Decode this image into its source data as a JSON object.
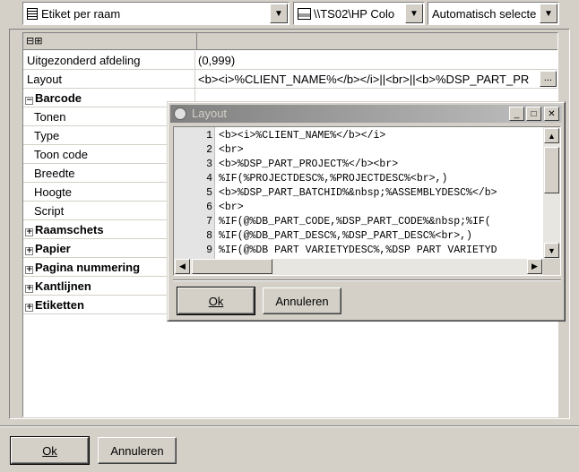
{
  "toolbar": {
    "template_value": "Etiket per raam",
    "template_icon": "grid-list-icon",
    "printer_value": "\\\\TS02\\HP Colo",
    "printer_icon": "printer-icon",
    "mode_value": "Automatisch selecte"
  },
  "grid": {
    "header_expand_glyphs": "⊟⊞",
    "rows": [
      {
        "label": "Uitgezonderd afdeling",
        "value": "(0,999)"
      },
      {
        "label": "Layout",
        "value": "<b><i>%CLIENT_NAME%</b></i>||<br>||<b>%DSP_PART_PR",
        "button": "..."
      },
      {
        "label": "Barcode",
        "expander": "−"
      },
      {
        "label": "Tonen"
      },
      {
        "label": "Type"
      },
      {
        "label": "Toon code"
      },
      {
        "label": "Breedte"
      },
      {
        "label": "Hoogte"
      },
      {
        "label": "Script"
      },
      {
        "label": "Raamschets",
        "expander": "+"
      },
      {
        "label": "Papier",
        "expander": "+"
      },
      {
        "label": "Pagina nummering",
        "expander": "+"
      },
      {
        "label": "Kantlijnen",
        "expander": "+"
      },
      {
        "label": "Etiketten",
        "expander": "+"
      }
    ]
  },
  "footer": {
    "ok_label": "Ok",
    "cancel_label": "Annuleren"
  },
  "dialog": {
    "title": "Layout",
    "lines": [
      {
        "n": "1",
        "text": "<b><i>%CLIENT_NAME%</b></i>"
      },
      {
        "n": "2",
        "text": "<br>"
      },
      {
        "n": "3",
        "text": "<b>%DSP_PART_PROJECT%</b><br>"
      },
      {
        "n": "4",
        "text": "%IF(%PROJECTDESC%,%PROJECTDESC%<br>,)"
      },
      {
        "n": "5",
        "text": "<b>%DSP_PART_BATCHID%&nbsp;%ASSEMBLYDESC%</b>"
      },
      {
        "n": "6",
        "text": "<br>"
      },
      {
        "n": "7",
        "text": "%IF(@%DB_PART_CODE,%DSP_PART_CODE%&nbsp;%IF("
      },
      {
        "n": "8",
        "text": "%IF(@%DB_PART_DESC%,%DSP_PART_DESC%<br>,)"
      },
      {
        "n": "9",
        "text": "%IF(@%DB PART VARIETYDESC%,%DSP PART VARIETYD"
      }
    ],
    "ok_label": "Ok",
    "cancel_label": "Annuleren"
  }
}
